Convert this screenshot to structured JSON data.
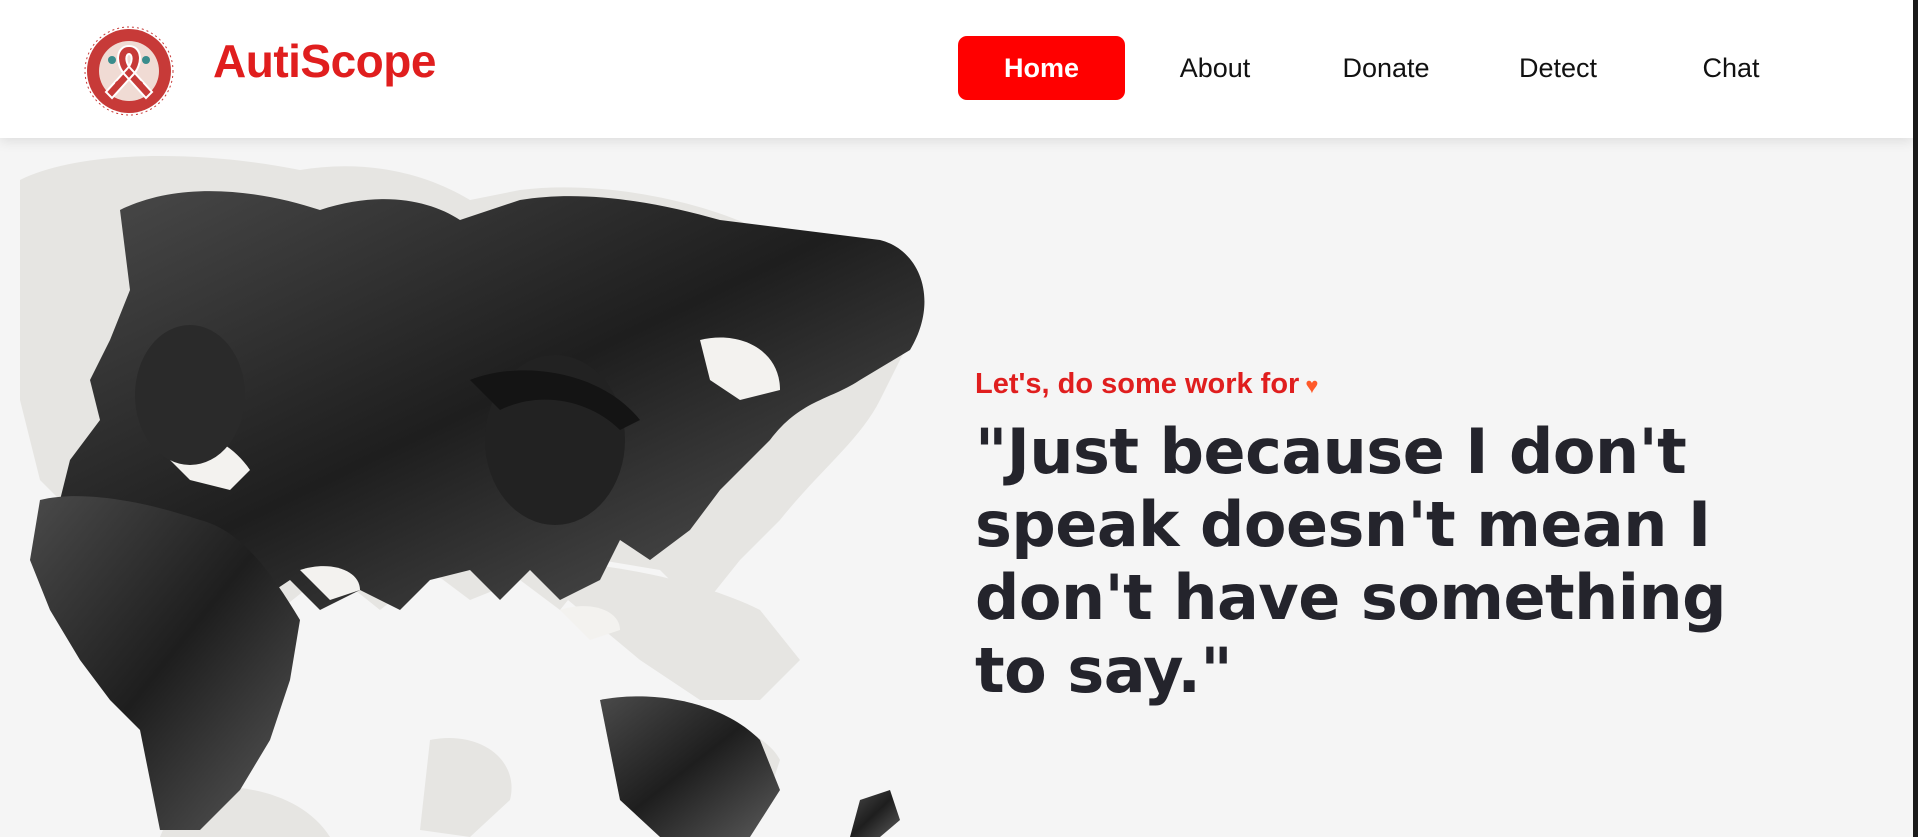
{
  "brand": {
    "name": "AutiScope",
    "logo_icon": "puzzle-ribbon-logo"
  },
  "nav": {
    "items": [
      {
        "label": "Home",
        "active": true
      },
      {
        "label": "About",
        "active": false
      },
      {
        "label": "Donate",
        "active": false
      },
      {
        "label": "Detect",
        "active": false
      },
      {
        "label": "Chat",
        "active": false
      }
    ]
  },
  "hero": {
    "tagline": "Let's, do some work for",
    "tagline_icon": "heart-icon",
    "quote": "\"Just because I don't speak doesn't mean I don't have something to say.\"",
    "image_description_icon": "world-map-children-photo"
  },
  "colors": {
    "accent": "#ff0000",
    "brand": "#e01e1e",
    "heading": "#24242c",
    "map_land": "#e6e5e2",
    "background": "#f5f5f5"
  }
}
